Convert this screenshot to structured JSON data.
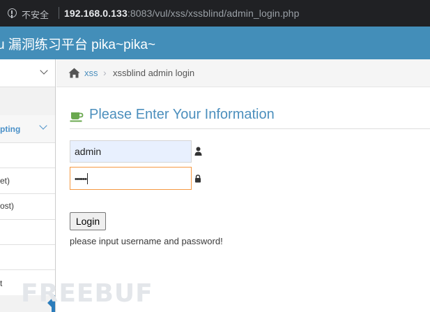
{
  "browser": {
    "security_label": "不安全",
    "url_host": "192.168.0.133",
    "url_rest": ":8083/vul/xss/xssblind/admin_login.php"
  },
  "header": {
    "title": "u 漏洞练习平台 pika~pika~"
  },
  "sidebar": {
    "items": [
      {
        "label": "",
        "has_chevron": true
      },
      {
        "label": "pting",
        "active": true,
        "has_chevron": true
      },
      {
        "label": ""
      },
      {
        "label": "et)"
      },
      {
        "label": "ost)"
      },
      {
        "label": ""
      },
      {
        "label": ""
      },
      {
        "label": "t"
      }
    ]
  },
  "breadcrumb": {
    "link": "xss",
    "separator": "›",
    "current": "xssblind admin login"
  },
  "form": {
    "heading": "Please Enter Your Information",
    "username_value": "admin",
    "password_mask": "••••••",
    "login_label": "Login",
    "hint": "please input username and password!"
  },
  "watermark": "FREEBUF",
  "colors": {
    "header_bg": "#438eb9",
    "link_blue": "#4c8fbd",
    "focus_orange": "#f59942",
    "icon_green": "#6aa84f"
  }
}
